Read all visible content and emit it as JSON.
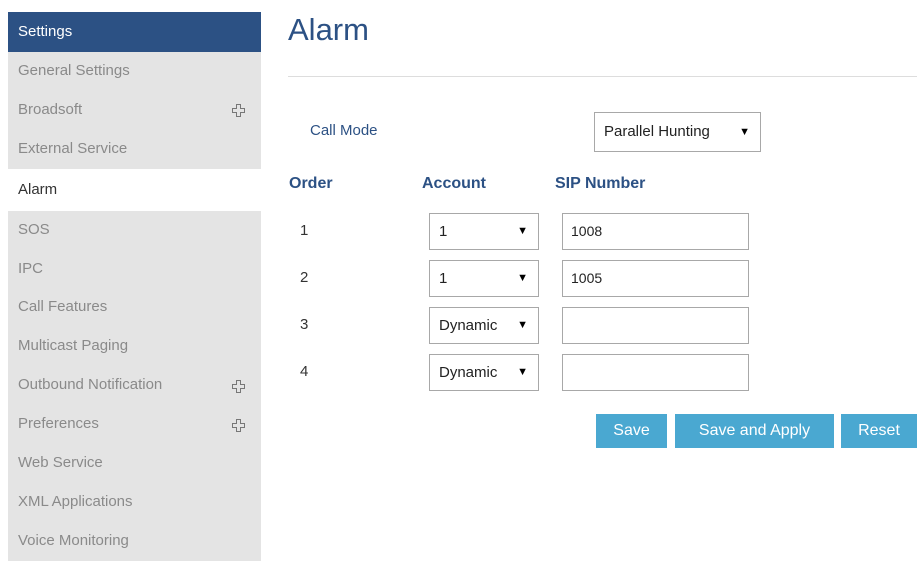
{
  "sidebar": {
    "header": "Settings",
    "items": [
      {
        "label": "General Settings"
      },
      {
        "label": "Broadsoft"
      },
      {
        "label": "External Service"
      },
      {
        "label": "Alarm"
      },
      {
        "label": "SOS"
      },
      {
        "label": "IPC"
      },
      {
        "label": "Call Features"
      },
      {
        "label": "Multicast Paging"
      },
      {
        "label": "Outbound Notification"
      },
      {
        "label": "Preferences"
      },
      {
        "label": "Web Service"
      },
      {
        "label": "XML Applications"
      },
      {
        "label": "Voice Monitoring"
      }
    ],
    "active_item": "Alarm",
    "expandable_items": [
      "Broadsoft",
      "Outbound Notification",
      "Preferences"
    ]
  },
  "main": {
    "title": "Alarm",
    "call_mode_label": "Call Mode",
    "call_mode_value": "Parallel Hunting",
    "columns": {
      "order": "Order",
      "account": "Account",
      "sip": "SIP Number"
    },
    "rows": [
      {
        "order": "1",
        "account": "1",
        "sip": "1008"
      },
      {
        "order": "2",
        "account": "1",
        "sip": "1005"
      },
      {
        "order": "3",
        "account": "Dynamic",
        "sip": ""
      },
      {
        "order": "4",
        "account": "Dynamic",
        "sip": ""
      }
    ],
    "buttons": {
      "save": "Save",
      "save_apply": "Save and Apply",
      "reset": "Reset"
    }
  },
  "colors": {
    "brand": "#2c5184",
    "button": "#4aa8d1",
    "sidebar_bg": "#e4e4e4"
  }
}
